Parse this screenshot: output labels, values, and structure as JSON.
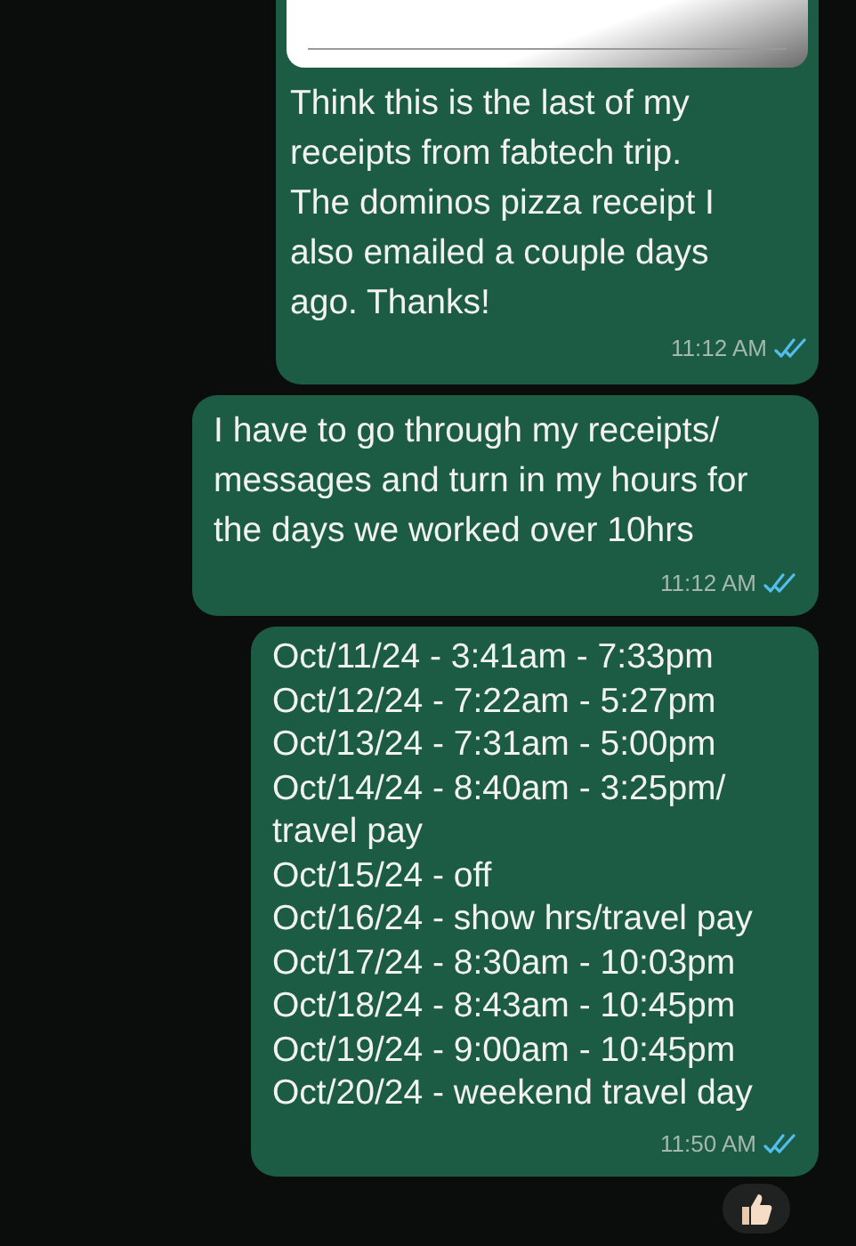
{
  "messages": [
    {
      "kind": "image",
      "text": "Think this is the last of my receipts from fabtech trip. The dominos pizza receipt I also emailed a couple days ago. Thanks!",
      "time": "11:12 AM",
      "read": true
    },
    {
      "kind": "text",
      "text": "I have to go through my receipts/ messages and turn in my hours for the days we worked over 10hrs",
      "time": "11:12 AM",
      "read": true
    },
    {
      "kind": "list",
      "lines": [
        "Oct/11/24 - 3:41am - 7:33pm",
        "Oct/12/24 - 7:22am - 5:27pm",
        "Oct/13/24 - 7:31am - 5:00pm",
        "Oct/14/24 - 8:40am - 3:25pm/ travel pay",
        "Oct/15/24 - off",
        "Oct/16/24 - show hrs/travel pay",
        "Oct/17/24 - 8:30am - 10:03pm",
        "Oct/18/24 - 8:43am - 10:45pm",
        "Oct/19/24 - 9:00am - 10:45pm",
        "Oct/20/24 - weekend travel day"
      ],
      "time": "11:50 AM",
      "read": true,
      "thumbs_up_reaction": true
    }
  ]
}
